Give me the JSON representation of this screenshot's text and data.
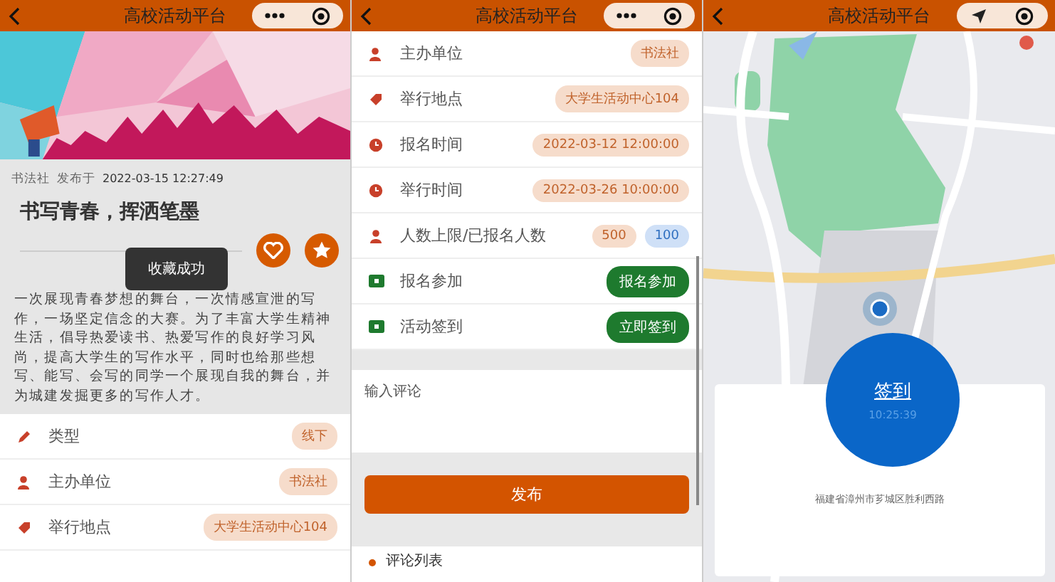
{
  "article_screen": {
    "header": {
      "title": "高校活动平台"
    },
    "author": "书法社",
    "published_label": "发布于",
    "published_at": "2022-03-15 12:27:49",
    "title": "书写青春，挥洒笔墨",
    "toast": "收藏成功",
    "description": "一次展现青春梦想的舞台，一次情感宣泄的写作，一场坚定信念的大赛。为了丰富大学生精神生活，倡导热爱读书、热爱写作的良好学习风尚，提高大学生的写作水平，同时也给那些想写、能写、会写的同学一个展现自我的舞台，并为城建发掘更多的写作人才。",
    "rows": [
      {
        "kind": "category",
        "label": "类型",
        "tag": "线下"
      },
      {
        "kind": "organizer",
        "label": "主办单位",
        "tag": "书法社"
      },
      {
        "kind": "venue",
        "label": "举行地点",
        "tag": "大学生活动中心104"
      }
    ]
  },
  "detail_screen": {
    "header": {
      "title": "高校活动平台"
    },
    "rows": [
      {
        "kind": "organizer",
        "label": "主办单位",
        "tag": "书法社"
      },
      {
        "kind": "venue",
        "label": "举行地点",
        "tag": "大学生活动中心104"
      },
      {
        "kind": "time",
        "label": "报名时间",
        "tag": "2022-03-12 12:00:00"
      },
      {
        "kind": "time",
        "label": "举行时间",
        "tag": "2022-03-26 10:00:00"
      },
      {
        "kind": "limit",
        "label": "人数上限/已报名人数",
        "counts": [
          {
            "text": "500",
            "color": "#f6dccb"
          },
          {
            "text": "100",
            "color": "#cfe0f7"
          }
        ]
      },
      {
        "kind": "signup",
        "label": "报名参加",
        "button": "报名参加"
      },
      {
        "kind": "checkin",
        "label": "活动签到",
        "button": "立即签到"
      }
    ],
    "comment": {
      "placeholder": "输入评论"
    },
    "publish_button": "发布",
    "comments_title": "评论列表"
  },
  "signin_screen": {
    "header": {
      "title": "高校活动平台"
    },
    "sign_button": "签到",
    "time": "10:25:39",
    "address": "福建省漳州市芗城区胜利西路"
  }
}
